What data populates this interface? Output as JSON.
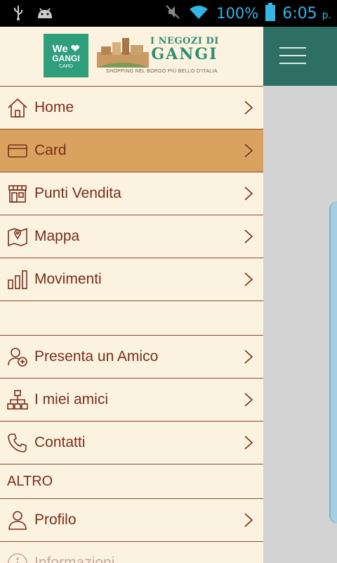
{
  "status_bar": {
    "battery": "100%",
    "time": "6:05",
    "time_suffix": "p."
  },
  "logo": {
    "we": "We",
    "gangi": "GANGI",
    "card": "CARD",
    "title_line1": "I NEGOZI DI",
    "title_line2": "GANGI",
    "subtitle": "SHOPPING NEL BORGO PIÙ BELLO D'ITALIA"
  },
  "menu": {
    "items": [
      {
        "label": "Home",
        "icon": "home-icon"
      },
      {
        "label": "Card",
        "icon": "card-icon",
        "active": true
      },
      {
        "label": "Punti Vendita",
        "icon": "store-icon"
      },
      {
        "label": "Mappa",
        "icon": "map-icon"
      },
      {
        "label": "Movimenti",
        "icon": "bar-chart-icon"
      },
      {
        "label": "Presenta un Amico",
        "icon": "add-user-icon"
      },
      {
        "label": "I miei amici",
        "icon": "network-icon"
      },
      {
        "label": "Contatti",
        "icon": "phone-icon"
      }
    ],
    "section_altro": "ALTRO",
    "items_altro": [
      {
        "label": "Profilo",
        "icon": "user-icon"
      },
      {
        "label": "Informazioni",
        "icon": "info-icon"
      }
    ]
  },
  "colors": {
    "drawer_bg": "#fbf3e0",
    "active_bg": "#d9a35f",
    "text": "#7a2e1c",
    "header_bar": "#2e6f63",
    "status_icons": "#33b5e5"
  }
}
